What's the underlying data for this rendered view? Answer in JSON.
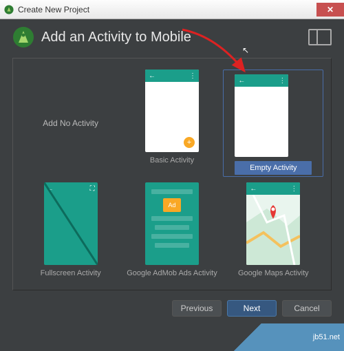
{
  "window": {
    "title": "Create New Project"
  },
  "header": {
    "title": "Add an Activity to Mobile"
  },
  "activities": {
    "none": "Add No Activity",
    "basic": "Basic Activity",
    "empty": "Empty Activity",
    "fullscreen": "Fullscreen Activity",
    "admob": "Google AdMob Ads Activity",
    "admob_badge": "Ad",
    "maps": "Google Maps Activity"
  },
  "buttons": {
    "previous": "Previous",
    "next": "Next",
    "cancel": "Cancel"
  },
  "watermark": "jb51.net",
  "colors": {
    "teal": "#1b9e8a",
    "select": "#4a6ea9",
    "fab": "#f9a825",
    "arrow": "#d22"
  }
}
